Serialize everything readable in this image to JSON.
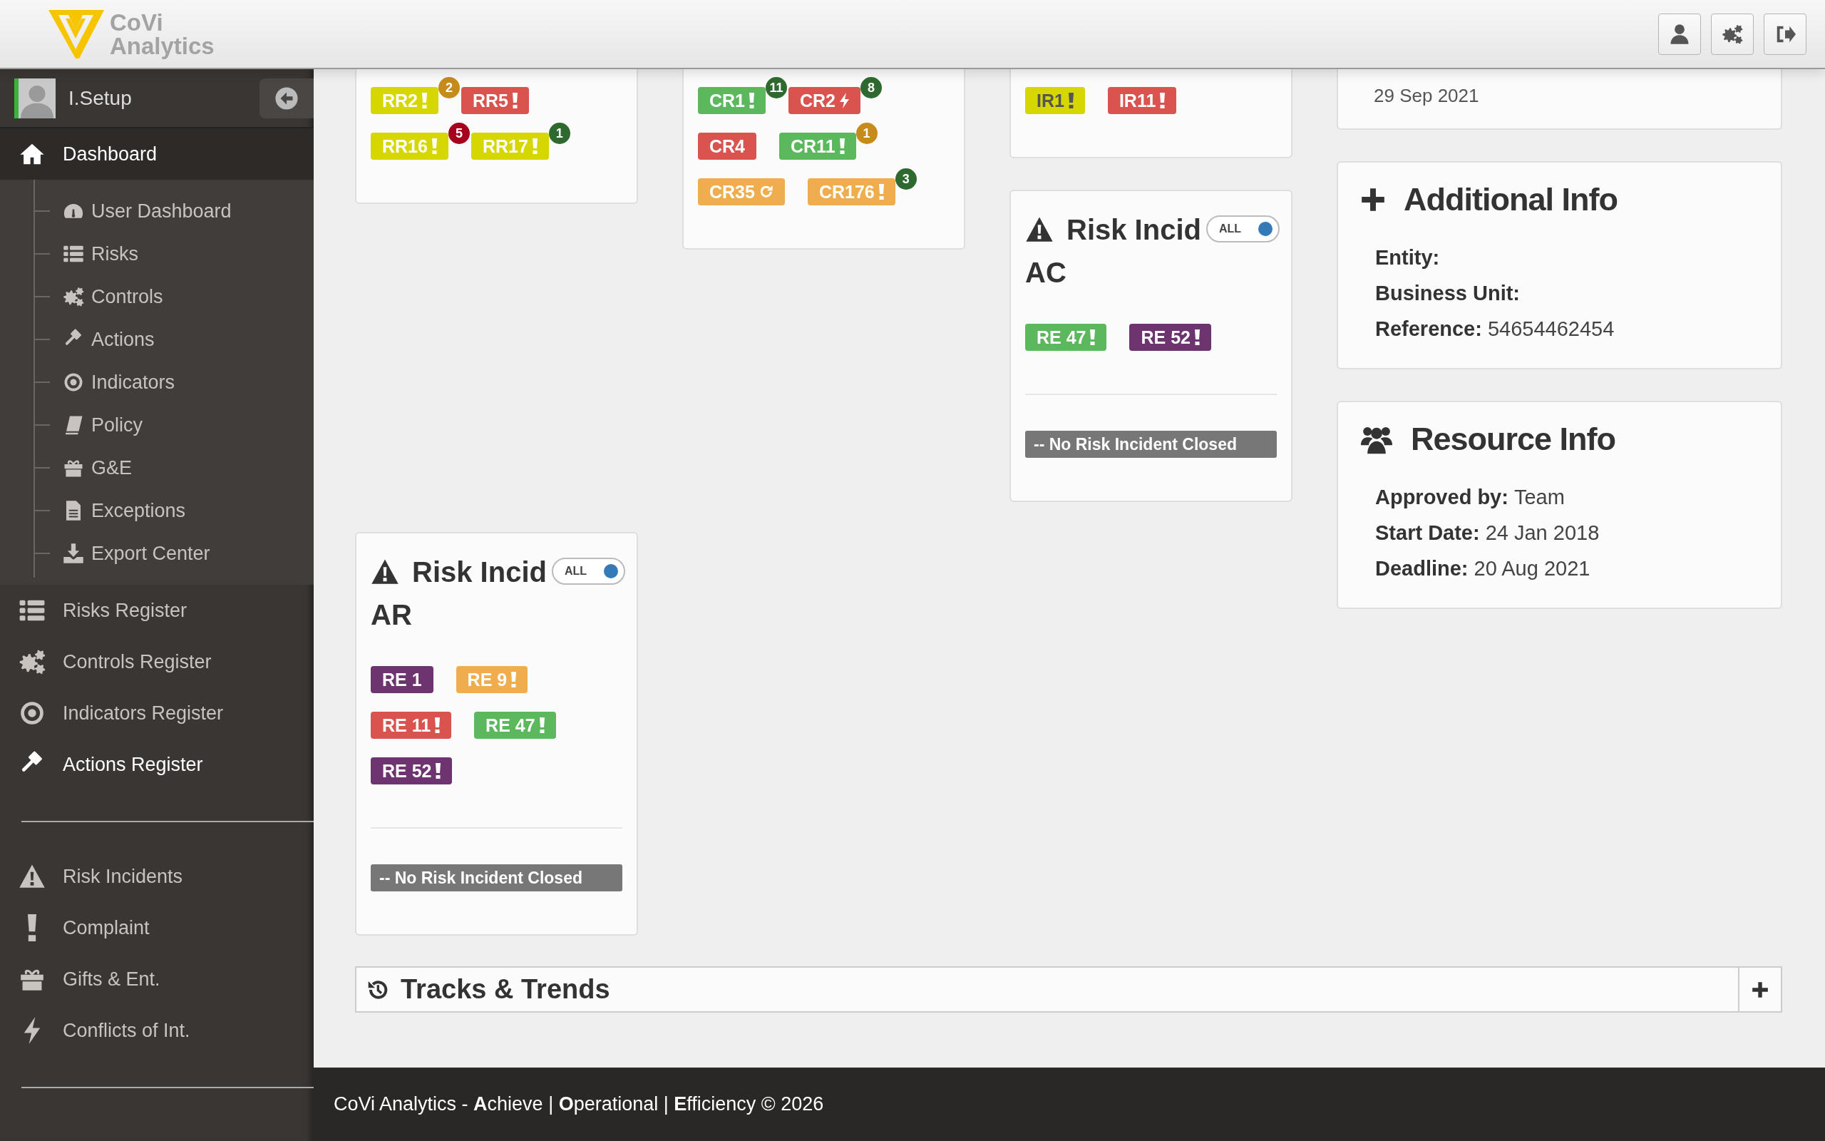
{
  "header": {
    "logo": {
      "line1": "CoVi",
      "line2": "Analytics"
    }
  },
  "sidebar": {
    "user": {
      "name": "I.Setup"
    },
    "sections": [
      {
        "items": [
          {
            "label": "Dashboard",
            "expanded": true,
            "children": [
              {
                "label": "User Dashboard",
                "selected": false
              },
              {
                "label": "Risks",
                "selected": false
              },
              {
                "label": "Controls",
                "selected": false
              },
              {
                "label": "Actions",
                "selected": false
              },
              {
                "label": "Indicators",
                "selected": false
              },
              {
                "label": "Policy",
                "selected": false
              },
              {
                "label": "G&E",
                "selected": false
              },
              {
                "label": "Exceptions",
                "selected": false
              },
              {
                "label": "Export Center",
                "selected": false
              }
            ]
          },
          {
            "label": "Risks Register",
            "selected": false
          },
          {
            "label": "Controls Register",
            "selected": false
          },
          {
            "label": "Indicators Register",
            "selected": false
          },
          {
            "label": "Actions Register",
            "selected": true
          }
        ]
      },
      {
        "items": [
          {
            "label": "Risk Incidents",
            "selected": false
          },
          {
            "label": "Complaint",
            "selected": false
          },
          {
            "label": "Gifts & Ent.",
            "selected": false
          },
          {
            "label": "Conflicts of Int.",
            "selected": false
          }
        ]
      }
    ]
  },
  "columns": [
    {
      "cards": [
        {
          "kind": "badges",
          "rows": [
            [
              {
                "label": "RR2",
                "color": "#d6d600",
                "kind": "alert",
                "count": {
                  "text": "2",
                  "color": "#c68b1c"
                }
              },
              {
                "label": "RR5",
                "color": "#d9534f",
                "kind": "alert"
              }
            ],
            [
              {
                "label": "RR16",
                "color": "#d6d600",
                "kind": "alert",
                "count": {
                  "text": "5",
                  "color": "#a5001e"
                }
              },
              {
                "label": "RR17",
                "color": "#d6d600",
                "kind": "alert",
                "count": {
                  "text": "1",
                  "color": "#2e6a2f"
                }
              }
            ]
          ]
        }
      ]
    },
    {
      "cards": [
        {
          "kind": "badges",
          "rows": [
            [
              {
                "label": "CR1",
                "color": "#5cb85c",
                "kind": "alert",
                "count": {
                  "text": "11",
                  "color": "#2e6a2f"
                }
              },
              {
                "label": "CR2",
                "color": "#d9534f",
                "kind": "bolt",
                "count": {
                  "text": "8",
                  "color": "#2e6a2f"
                }
              }
            ],
            [
              {
                "label": "CR4",
                "color": "#d9534f",
                "kind": "plain"
              },
              {
                "label": "CR11",
                "color": "#5cb85c",
                "kind": "alert",
                "count": {
                  "text": "1",
                  "color": "#c68b1c"
                }
              }
            ],
            [
              {
                "label": "CR35",
                "color": "#f0ad4e",
                "kind": "repeat"
              },
              {
                "label": "CR176",
                "color": "#f0ad4e",
                "kind": "alert",
                "count": {
                  "text": "3",
                  "color": "#2e6a2f"
                }
              }
            ]
          ]
        }
      ]
    },
    {
      "cards": [
        {
          "kind": "badges",
          "rows": [
            [
              {
                "label": "IR1",
                "color": "#d6d600",
                "kind": "alert",
                "dark_text": true
              },
              {
                "label": "IR11",
                "color": "#d9534f",
                "kind": "alert",
                "dark_text": false
              }
            ]
          ]
        },
        {
          "kind": "incidents",
          "title": "Risk Incid",
          "subtitle": "AC",
          "toggle": {
            "label": "ALL",
            "on": true
          },
          "rows": [
            [
              {
                "label": "RE 47",
                "color": "#5cb85c",
                "kind": "alert"
              },
              {
                "label": "RE 52",
                "color": "#6d3470",
                "kind": "alert"
              }
            ]
          ],
          "closed": "-- No Risk Incident Closed"
        }
      ]
    },
    {
      "cards": [
        {
          "kind": "dates",
          "lines": [
            "29 Sep 2021"
          ]
        },
        {
          "kind": "info",
          "title": "Additional Info",
          "fields": [
            {
              "label": "Entity:"
            },
            {
              "label": "Business Unit:"
            },
            {
              "label": "Reference:",
              "value": "54654462454"
            }
          ]
        },
        {
          "kind": "info",
          "title": "Resource Info",
          "fields": [
            {
              "label": "Approved by:",
              "value": "Team"
            },
            {
              "label": "Start Date:",
              "value": "24 Jan 2018"
            },
            {
              "label": "Deadline:",
              "value": "20 Aug 2021"
            }
          ]
        }
      ]
    }
  ],
  "lower_cards": [
    {
      "kind": "incidents",
      "title": "Risk Incid",
      "subtitle": "AR",
      "toggle": {
        "label": "ALL",
        "on": true
      },
      "rows": [
        [
          {
            "label": "RE 1",
            "color": "#6d3470",
            "kind": "plain"
          },
          {
            "label": "RE 9",
            "color": "#f0ad4e",
            "kind": "alert"
          }
        ],
        [
          {
            "label": "RE 11",
            "color": "#d9534f",
            "kind": "alert"
          },
          {
            "label": "RE 47",
            "color": "#5cb85c",
            "kind": "alert"
          }
        ],
        [
          {
            "label": "RE 52",
            "color": "#6d3470",
            "kind": "alert"
          }
        ]
      ],
      "closed": "-- No Risk Incident Closed"
    }
  ],
  "tracks": {
    "title": "Tracks & Trends"
  },
  "footer": {
    "text": "CoVi Analytics - **A**chieve | **O**perational | **E**fficiency © 2026"
  }
}
